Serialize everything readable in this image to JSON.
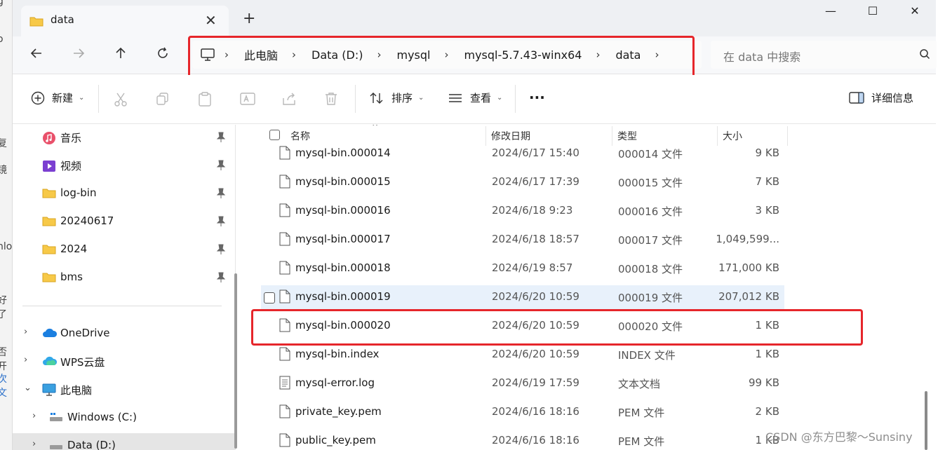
{
  "window": {
    "tab_title": "data",
    "minimize": "—",
    "maximize": "☐",
    "close": "✕",
    "new_tab": "+",
    "tab_close": "✕"
  },
  "address": {
    "crumbs": [
      "此电脑",
      "Data (D:)",
      "mysql",
      "mysql-5.7.43-winx64",
      "data"
    ],
    "separator": "›"
  },
  "search": {
    "placeholder": "在 data 中搜索"
  },
  "toolbar": {
    "new_label": "新建",
    "sort_label": "排序",
    "view_label": "查看",
    "more_label": "···",
    "details_label": "详细信息"
  },
  "nav_pane": {
    "quick_access": [
      {
        "label": "音乐",
        "icon": "music-icon"
      },
      {
        "label": "视频",
        "icon": "video-icon"
      },
      {
        "label": "log-bin",
        "icon": "folder-icon"
      },
      {
        "label": "20240617",
        "icon": "folder-icon"
      },
      {
        "label": "2024",
        "icon": "folder-icon"
      },
      {
        "label": "bms",
        "icon": "folder-icon"
      }
    ],
    "tree": [
      {
        "label": "OneDrive",
        "expander": "›"
      },
      {
        "label": "WPS云盘",
        "expander": "›"
      },
      {
        "label": "此电脑",
        "expander": "⌄"
      },
      {
        "label": "Windows (C:)",
        "expander": "›"
      },
      {
        "label": "Data (D:)",
        "expander": "›"
      }
    ]
  },
  "columns": {
    "name": "名称",
    "date": "修改日期",
    "type": "类型",
    "size": "大小"
  },
  "files": [
    {
      "name": "mysql-bin.000014",
      "date": "2024/6/17 15:40",
      "type": "000014 文件",
      "size": "9 KB"
    },
    {
      "name": "mysql-bin.000015",
      "date": "2024/6/17 17:39",
      "type": "000015 文件",
      "size": "7 KB"
    },
    {
      "name": "mysql-bin.000016",
      "date": "2024/6/18 9:23",
      "type": "000016 文件",
      "size": "3 KB"
    },
    {
      "name": "mysql-bin.000017",
      "date": "2024/6/18 18:57",
      "type": "000017 文件",
      "size": "1,049,599..."
    },
    {
      "name": "mysql-bin.000018",
      "date": "2024/6/19 8:57",
      "type": "000018 文件",
      "size": "171,000 KB"
    },
    {
      "name": "mysql-bin.000019",
      "date": "2024/6/20 10:59",
      "type": "000019 文件",
      "size": "207,012 KB"
    },
    {
      "name": "mysql-bin.000020",
      "date": "2024/6/20 10:59",
      "type": "000020 文件",
      "size": "1 KB"
    },
    {
      "name": "mysql-bin.index",
      "date": "2024/6/20 10:59",
      "type": "INDEX 文件",
      "size": "1 KB"
    },
    {
      "name": "mysql-error.log",
      "date": "2024/6/19 17:59",
      "type": "文本文档",
      "size": "99 KB"
    },
    {
      "name": "private_key.pem",
      "date": "2024/6/16 18:16",
      "type": "PEM 文件",
      "size": "2 KB"
    },
    {
      "name": "public_key.pem",
      "date": "2024/6/16 18:16",
      "type": "PEM 文件",
      "size": "1 KB"
    }
  ],
  "background_window_fragments": [
    "g",
    "o",
    "复",
    "镜",
    "nlo",
    "好了",
    "否开",
    "次文"
  ],
  "watermark": "CSDN @东方巴黎～Sunsiny",
  "colors": {
    "highlight_box": "#e6262b",
    "accent": "#0067c0",
    "hover_row": "#e8f1fb"
  }
}
